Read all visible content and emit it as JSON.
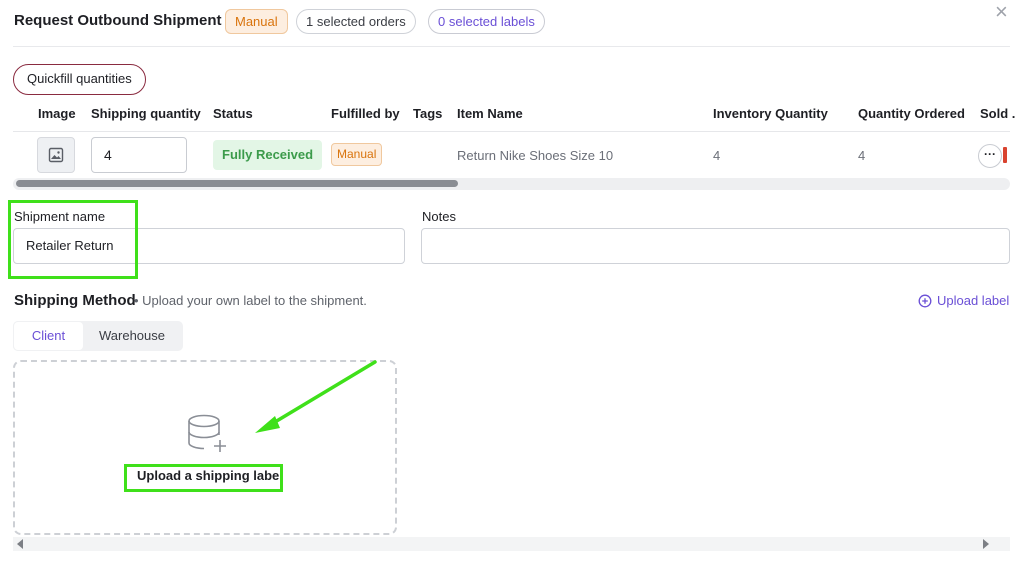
{
  "header": {
    "title": "Request Outbound Shipment",
    "type_badge": "Manual",
    "selected_orders": "1 selected orders",
    "selected_labels": "0 selected labels",
    "close_glyph": "×"
  },
  "quickfill_label": "Quickfill quantities",
  "table": {
    "columns": [
      "Image",
      "Shipping quantity",
      "Status",
      "Fulfilled by",
      "Tags",
      "Item Name",
      "Inventory Quantity",
      "Quantity Ordered",
      "Sold ."
    ],
    "rows": [
      {
        "image": "image-placeholder-icon",
        "shipping_quantity": "4",
        "status": "Fully Received",
        "fulfilled_by": "Manual",
        "tags": "",
        "item_name": "Return Nike Shoes Size 10",
        "inventory_quantity": "4",
        "quantity_ordered": "4",
        "actions": "···"
      }
    ]
  },
  "form": {
    "shipment_name_label": "Shipment name",
    "shipment_name_value": "Retailer Return",
    "notes_label": "Notes",
    "notes_value": ""
  },
  "shipping_method": {
    "title": "Shipping Method",
    "hint": "• Upload your own label to the shipment.",
    "upload_link": "Upload label",
    "tabs": [
      {
        "label": "Client",
        "active": true
      },
      {
        "label": "Warehouse",
        "active": false
      }
    ],
    "dropzone_text": "Upload a shipping label"
  },
  "colors": {
    "accent": "#6a4fd6",
    "manual_orange": "#d9740d",
    "success_green": "#3c9b4b",
    "highlight_green": "#3fe01a"
  }
}
